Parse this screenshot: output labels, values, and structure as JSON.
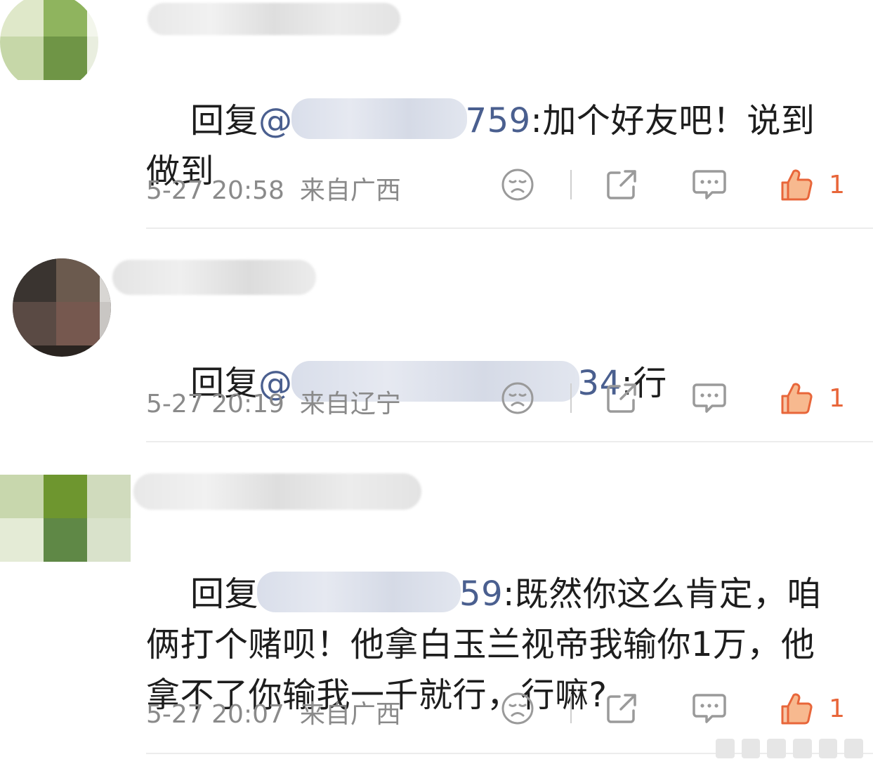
{
  "comments": [
    {
      "reply_prefix": "回复",
      "mention_head": "@",
      "mention_tail": "759",
      "text": ":加个好友吧！说到做到",
      "time": "5-27 20:58",
      "location": "来自广西",
      "likes": "1"
    },
    {
      "reply_prefix": "回复",
      "mention_head": "@",
      "mention_tail": "34",
      "text": ":行",
      "time": "5-27 20:19",
      "location": "来自辽宁",
      "likes": "1"
    },
    {
      "reply_prefix": "回复",
      "mention_head": "",
      "mention_tail": "59",
      "text": ":既然你这么肯定，咱俩打个赌呗！他拿白玉兰视帝我输你1万，他拿不了你输我一千就行，行嘛?",
      "time": "5-27 20:07",
      "location": "来自广西",
      "likes": "1"
    }
  ],
  "icons": {
    "dislike": "sad-face-icon",
    "share": "share-icon",
    "reply": "comment-bubble-icon",
    "like": "thumbs-up-icon"
  },
  "colors": {
    "mention": "#4a5f8f",
    "like": "#e8663a",
    "meta": "#8a8a8a"
  }
}
